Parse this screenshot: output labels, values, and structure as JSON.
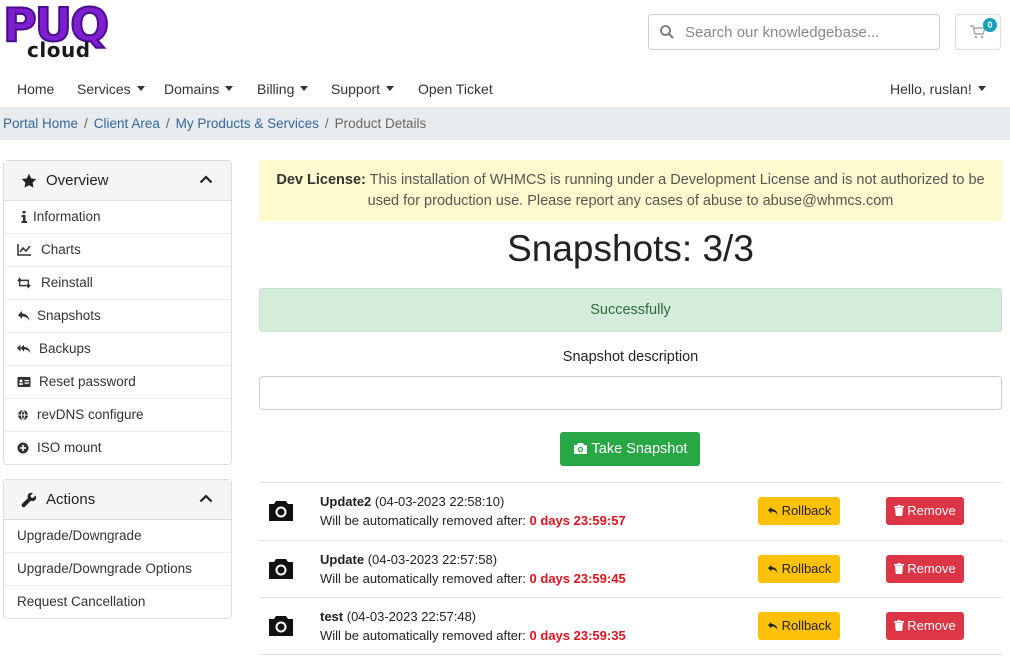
{
  "brand": {
    "logo_top": "PUQ",
    "logo_bottom": "cloud"
  },
  "search": {
    "placeholder": "Search our knowledgebase..."
  },
  "cart": {
    "count": "0"
  },
  "nav": {
    "items": [
      "Home",
      "Services",
      "Domains",
      "Billing",
      "Support",
      "Open Ticket"
    ],
    "user": "Hello, ruslan!"
  },
  "breadcrumb": {
    "items": [
      "Portal Home",
      "Client Area",
      "My Products & Services"
    ],
    "active": "Product Details",
    "separator": "/"
  },
  "sidebar": {
    "overview_title": "Overview",
    "overview_items": [
      "Information",
      "Charts",
      "Reinstall",
      "Snapshots",
      "Backups",
      "Reset password",
      "revDNS configure",
      "ISO mount"
    ],
    "actions_title": "Actions",
    "actions_items": [
      "Upgrade/Downgrade",
      "Upgrade/Downgrade Options",
      "Request Cancellation"
    ]
  },
  "dev_alert": {
    "bold": "Dev License:",
    "text": "This installation of WHMCS is running under a Development License and is not authorized to be used for production use. Please report any cases of abuse to abuse@whmcs.com"
  },
  "snapshots_title": "Snapshots: 3/3",
  "success_message": "Successfully",
  "description_label": "Snapshot description",
  "description_value": "",
  "take_snapshot_label": "Take Snapshot",
  "remove_prefix": "Will be automatically removed after:",
  "snapshots": [
    {
      "name": "Update2",
      "date": "(04-03-2023 22:58:10)",
      "remaining": "0 days 23:59:57"
    },
    {
      "name": "Update",
      "date": "(04-03-2023 22:57:58)",
      "remaining": "0 days 23:59:45"
    },
    {
      "name": "test",
      "date": "(04-03-2023 22:57:48)",
      "remaining": "0 days 23:59:35"
    }
  ],
  "rollback_label": "Rollback",
  "remove_label": "Remove",
  "colors": {
    "brand": "#7e1fcf",
    "success_button": "#28a745",
    "rollback": "#ffc107",
    "remove": "#dc3545",
    "link": "#336699"
  }
}
